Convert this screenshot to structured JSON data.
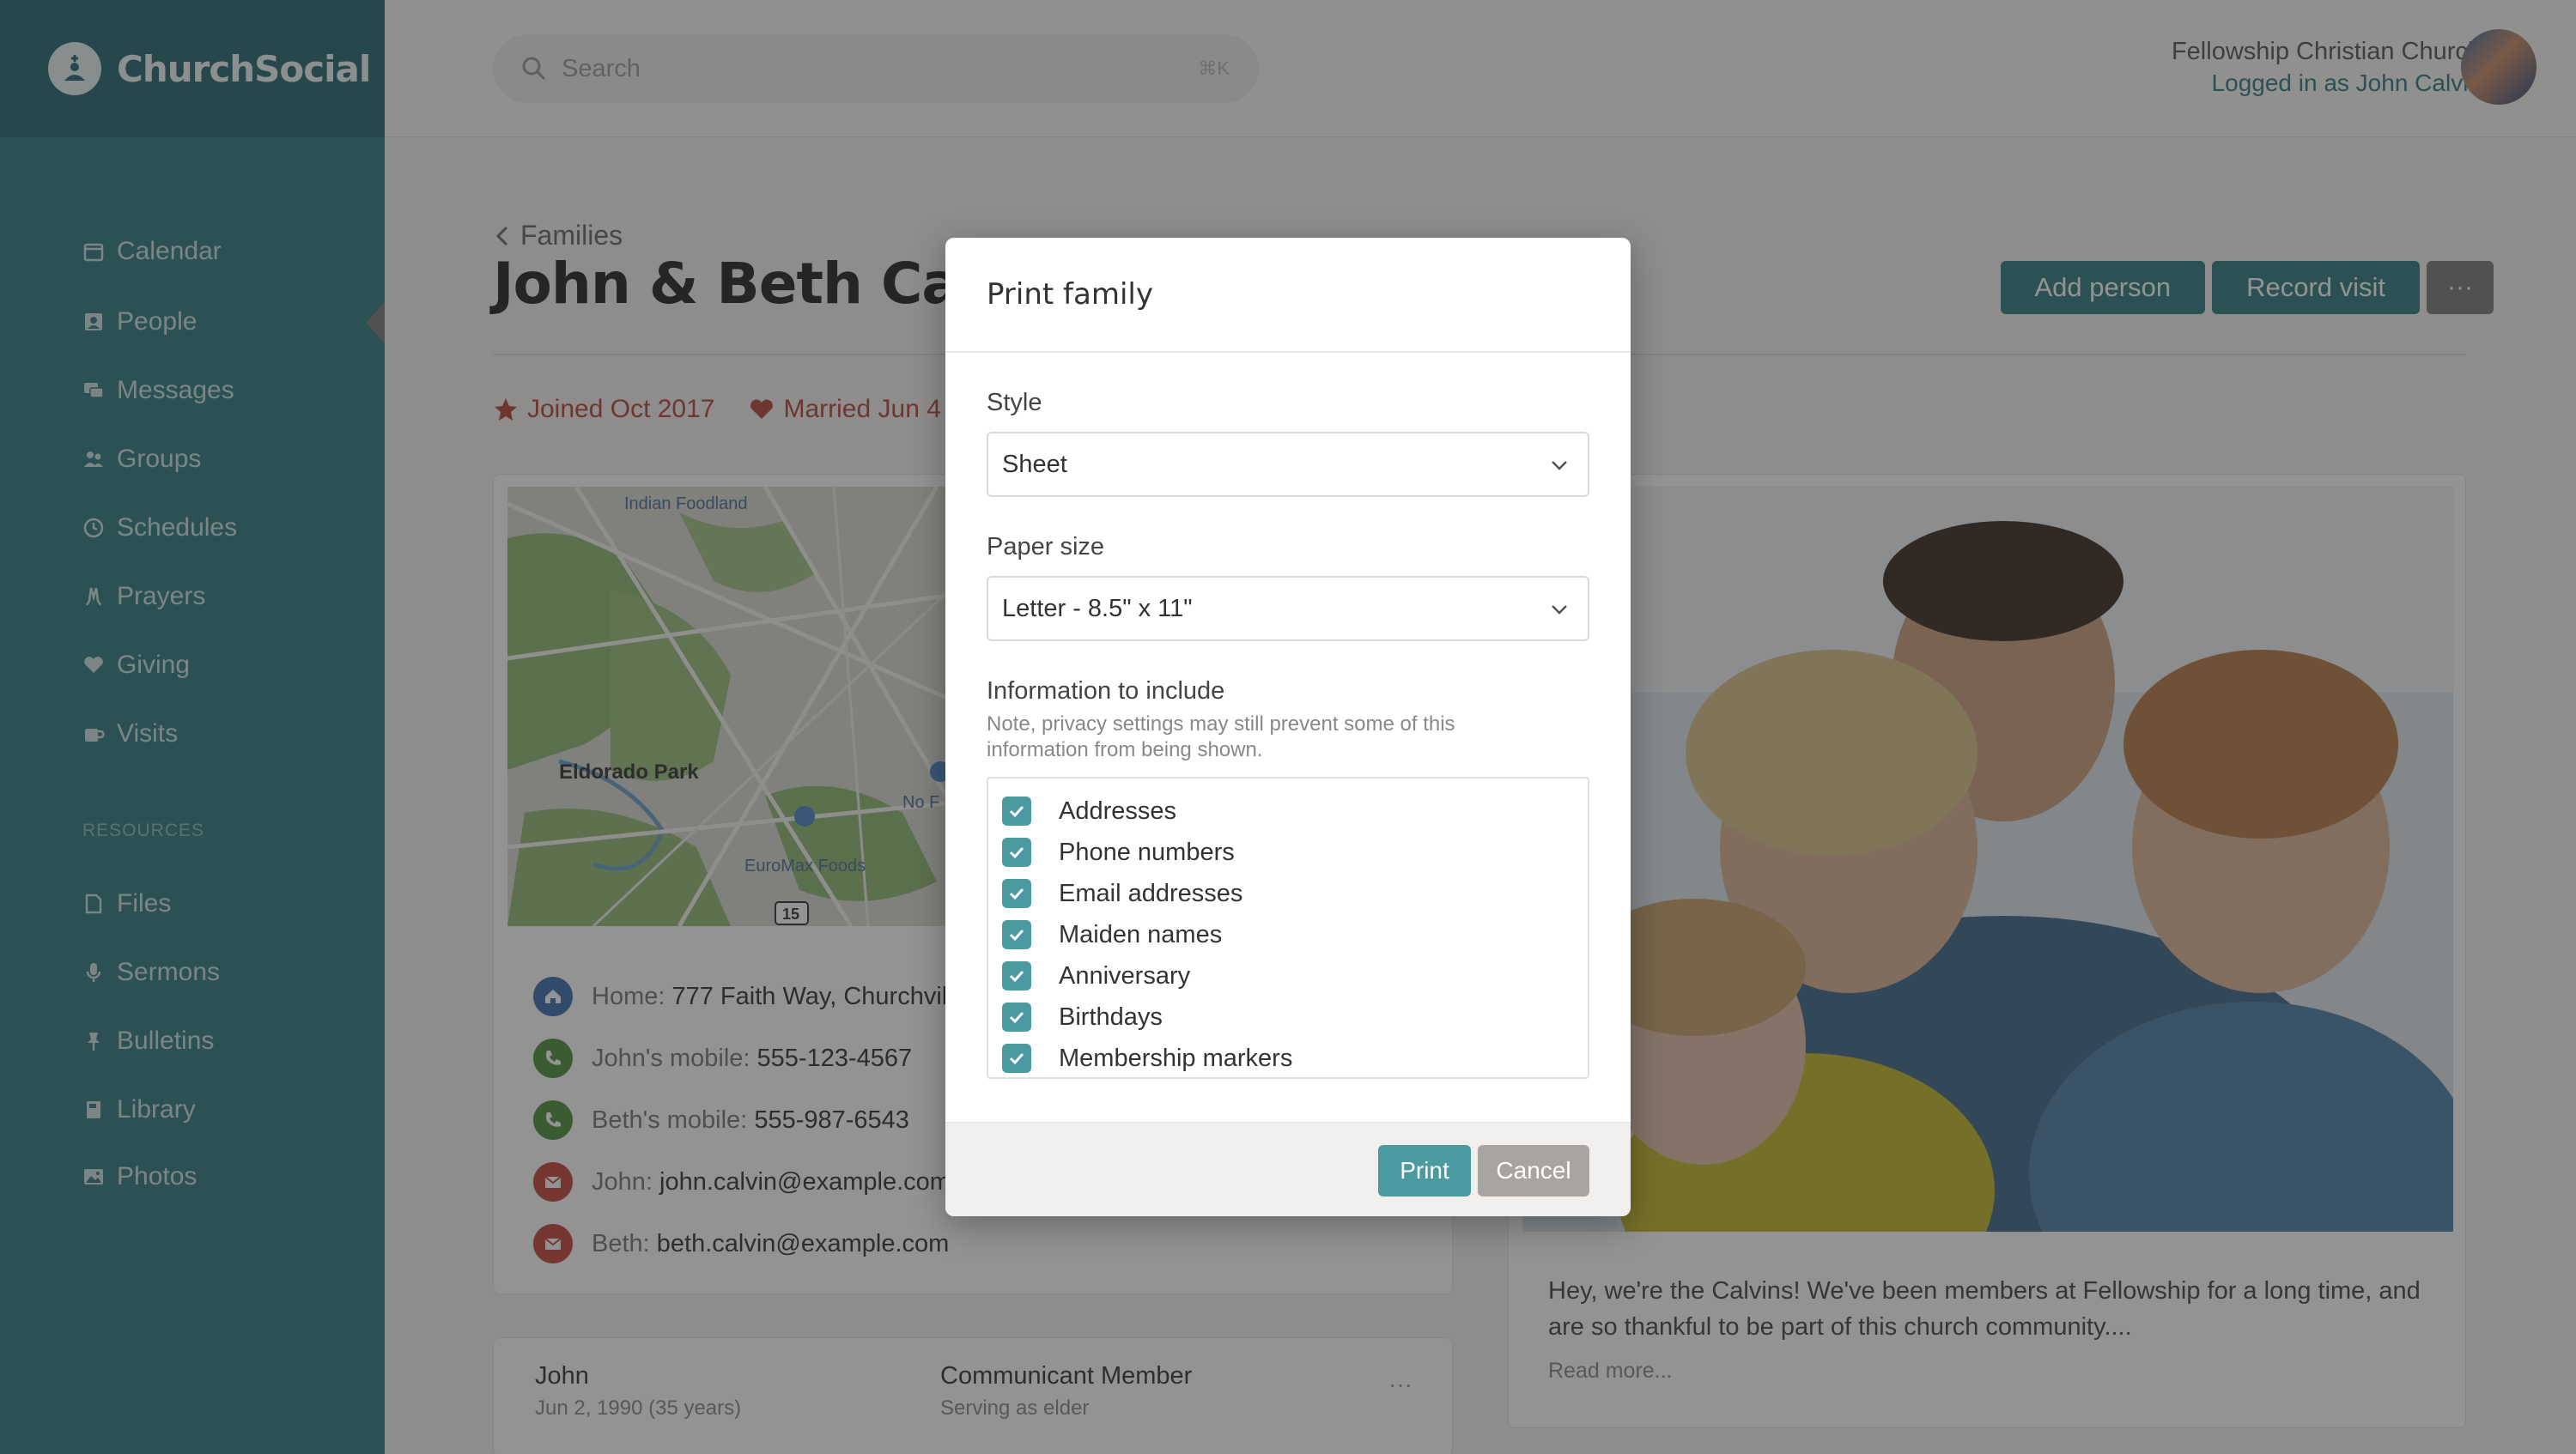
{
  "app": {
    "name": "ChurchSocial",
    "accent": "#2f7a82",
    "sidebar_bg": "#2f7a82",
    "danger": "#b5443a"
  },
  "sidebar": {
    "items": [
      {
        "label": "Calendar",
        "icon": "calendar-icon"
      },
      {
        "label": "People",
        "icon": "person-card-icon"
      },
      {
        "label": "Messages",
        "icon": "messages-icon"
      },
      {
        "label": "Groups",
        "icon": "groups-icon"
      },
      {
        "label": "Schedules",
        "icon": "clock-icon"
      },
      {
        "label": "Prayers",
        "icon": "praying-hands-icon"
      },
      {
        "label": "Giving",
        "icon": "heart-icon"
      },
      {
        "label": "Visits",
        "icon": "mug-icon"
      }
    ],
    "resources_header": "RESOURCES",
    "resources": [
      {
        "label": "Files",
        "icon": "file-icon"
      },
      {
        "label": "Sermons",
        "icon": "microphone-icon"
      },
      {
        "label": "Bulletins",
        "icon": "pin-icon"
      },
      {
        "label": "Library",
        "icon": "book-icon"
      },
      {
        "label": "Photos",
        "icon": "image-icon"
      }
    ]
  },
  "topbar": {
    "search_placeholder": "Search",
    "search_shortcut": "⌘K",
    "org_name": "Fellowship Christian Church",
    "logged_in": "Logged in as John Calvin"
  },
  "page": {
    "back_label": "Families",
    "title": "John & Beth Calv",
    "add_person": "Add person",
    "record_visit": "Record visit",
    "more": "···",
    "markers": [
      "Joined Oct 2017",
      "Married Jun 4"
    ]
  },
  "map": {
    "labels": [
      "Indian Foodland",
      "Eldorado Park",
      "EuroMax Foods",
      "No F",
      "15"
    ]
  },
  "contacts": [
    {
      "label": "Home:",
      "value": "777 Faith Way, Churchvill",
      "type": "home",
      "color": "#3d6fb0"
    },
    {
      "label": "John's mobile:",
      "value": "555-123-4567",
      "type": "phone",
      "color": "#4f8f3c"
    },
    {
      "label": "Beth's mobile:",
      "value": "555-987-6543",
      "type": "phone",
      "color": "#4f8f3c"
    },
    {
      "label": "John:",
      "value": "john.calvin@example.com",
      "type": "email",
      "color": "#c5453a"
    },
    {
      "label": "Beth:",
      "value": "beth.calvin@example.com",
      "type": "email",
      "color": "#c5453a"
    }
  ],
  "member": {
    "name": "John",
    "birth": "Jun 2, 1990 (35 years)",
    "role": "Communicant Member",
    "role_sub": "Serving as elder",
    "more": "···"
  },
  "bio": {
    "text": "Hey, we're the Calvins! We've been members at Fellowship for a long time, and are so thankful to be part of this church community....",
    "read_more": "Read more..."
  },
  "modal": {
    "title": "Print family",
    "style_label": "Style",
    "style_value": "Sheet",
    "paper_label": "Paper size",
    "paper_value": "Letter - 8.5\" x 11\"",
    "info_label": "Information to include",
    "info_note": "Note, privacy settings may still prevent some of this information from being shown.",
    "options": [
      {
        "label": "Addresses",
        "checked": true
      },
      {
        "label": "Phone numbers",
        "checked": true
      },
      {
        "label": "Email addresses",
        "checked": true
      },
      {
        "label": "Maiden names",
        "checked": true
      },
      {
        "label": "Anniversary",
        "checked": true
      },
      {
        "label": "Birthdays",
        "checked": true
      },
      {
        "label": "Membership markers",
        "checked": true
      }
    ],
    "print_label": "Print",
    "cancel_label": "Cancel"
  }
}
